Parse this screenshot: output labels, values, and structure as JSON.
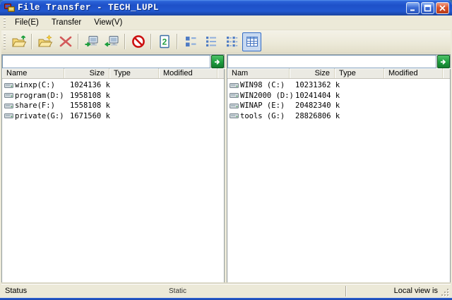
{
  "window": {
    "title": "File Transfer - TECH_LUPL",
    "controls": [
      "minimize-icon",
      "maximize-icon",
      "close-icon"
    ]
  },
  "menu": {
    "items": [
      "File(E)",
      "Transfer",
      "View(V)"
    ]
  },
  "toolbar": {
    "icons": [
      "open-folder-arrow-icon",
      "new-folder-icon",
      "delete-icon",
      "upload-to-remote-icon",
      "download-from-remote-icon",
      "abort-icon",
      "dual-page-icon",
      "large-icons-view-icon",
      "list-view-icon",
      "small-icons-view-icon",
      "details-view-icon"
    ],
    "active_icon": "details-view-icon"
  },
  "panes": {
    "local": {
      "address_value": "",
      "go_icon": "green-arrow-icon",
      "columns": [
        "Name",
        "Size",
        "Type",
        "Modified"
      ],
      "rows": [
        {
          "icon": "drive-icon",
          "name": "winxp(C:)",
          "size": "1024136 k"
        },
        {
          "icon": "drive-icon",
          "name": "program(D:)",
          "size": "1958108 k"
        },
        {
          "icon": "drive-icon",
          "name": "share(F:)",
          "size": "1558108 k"
        },
        {
          "icon": "drive-icon",
          "name": "private(G:)",
          "size": "1671560 k"
        }
      ]
    },
    "remote": {
      "address_value": "",
      "go_icon": "green-arrow-icon",
      "columns": [
        "Nam",
        "Size",
        "Type",
        "Modified"
      ],
      "rows": [
        {
          "icon": "drive-icon",
          "name": "WIN98 (C:)",
          "size": "10231362 k"
        },
        {
          "icon": "drive-icon",
          "name": "WIN2000 (D:)",
          "size": "10241404 k"
        },
        {
          "icon": "drive-icon",
          "name": "WINAP (E:)",
          "size": "20482340 k"
        },
        {
          "icon": "drive-icon",
          "name": "tools (G:)",
          "size": "28826806 k"
        }
      ]
    }
  },
  "statusbar": {
    "left": "Status",
    "center": "Static",
    "right": "Local view is"
  },
  "colors": {
    "titlebar_blue": "#1E50C8",
    "chrome_tan": "#ECE9D8",
    "go_green": "#1E9E3E",
    "abort_red": "#CC1111",
    "active_view_bg": "#C8D9F0",
    "header_bg": "#EBEAE3"
  }
}
